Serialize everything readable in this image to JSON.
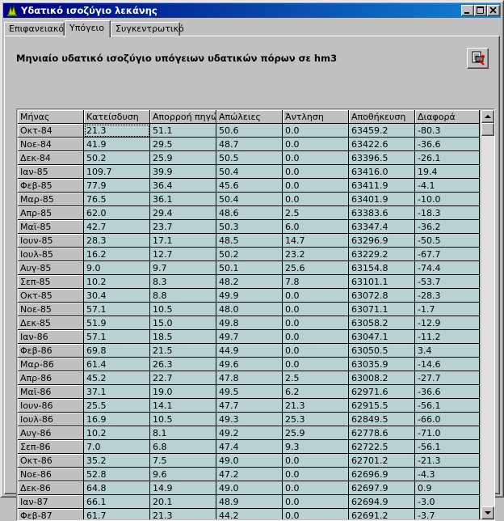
{
  "window": {
    "title": "Υδατικό ισοζύγιο λεκάνης"
  },
  "tabs": [
    {
      "label": "Επιφανειακό",
      "active": false
    },
    {
      "label": "Υπόγειο",
      "active": true
    },
    {
      "label": "Συγκεντρωτικό",
      "active": false
    }
  ],
  "heading": "Μηνιαίο υδατικό ισοζύγιο υπόγειων υδατικών πόρων σε hm3",
  "icons": {
    "app": "app-icon",
    "print": "print-report-icon"
  },
  "table": {
    "columns": [
      "Μήνας",
      "Κατείσδυση",
      "Απορροή πηγών",
      "Απώλειες",
      "Άντληση",
      "Αποθήκευση",
      "Διαφορά"
    ],
    "rows": [
      [
        "Οκτ-84",
        "21.3",
        "51.1",
        "50.6",
        "0.0",
        "63459.2",
        "-80.3"
      ],
      [
        "Νοε-84",
        "41.9",
        "29.5",
        "48.7",
        "0.0",
        "63422.6",
        "-36.6"
      ],
      [
        "Δεκ-84",
        "50.2",
        "25.9",
        "50.5",
        "0.0",
        "63396.5",
        "-26.1"
      ],
      [
        "Ιαν-85",
        "109.7",
        "39.9",
        "50.4",
        "0.0",
        "63416.0",
        "19.4"
      ],
      [
        "Φεβ-85",
        "77.9",
        "36.4",
        "45.6",
        "0.0",
        "63411.9",
        "-4.1"
      ],
      [
        "Μαρ-85",
        "76.5",
        "36.1",
        "50.4",
        "0.0",
        "63401.9",
        "-10.0"
      ],
      [
        "Απρ-85",
        "62.0",
        "29.4",
        "48.6",
        "2.5",
        "63383.6",
        "-18.3"
      ],
      [
        "Μαϊ-85",
        "42.7",
        "23.7",
        "50.3",
        "6.0",
        "63347.4",
        "-36.2"
      ],
      [
        "Ιουν-85",
        "28.3",
        "17.1",
        "48.5",
        "14.7",
        "63296.9",
        "-50.5"
      ],
      [
        "Ιουλ-85",
        "16.2",
        "12.7",
        "50.2",
        "23.2",
        "63229.2",
        "-67.7"
      ],
      [
        "Αυγ-85",
        "9.0",
        "9.7",
        "50.1",
        "25.6",
        "63154.8",
        "-74.4"
      ],
      [
        "Σεπ-85",
        "10.2",
        "8.3",
        "48.2",
        "7.8",
        "63101.1",
        "-53.7"
      ],
      [
        "Οκτ-85",
        "30.4",
        "8.8",
        "49.9",
        "0.0",
        "63072.8",
        "-28.3"
      ],
      [
        "Νοε-85",
        "57.1",
        "10.5",
        "48.0",
        "0.0",
        "63071.1",
        "-1.7"
      ],
      [
        "Δεκ-85",
        "51.9",
        "15.0",
        "49.8",
        "0.0",
        "63058.2",
        "-12.9"
      ],
      [
        "Ιαν-86",
        "57.1",
        "18.5",
        "49.7",
        "0.0",
        "63047.1",
        "-11.2"
      ],
      [
        "Φεβ-86",
        "69.8",
        "21.5",
        "44.9",
        "0.0",
        "63050.5",
        "3.4"
      ],
      [
        "Μαρ-86",
        "61.4",
        "26.3",
        "49.6",
        "0.0",
        "63035.9",
        "-14.6"
      ],
      [
        "Απρ-86",
        "45.2",
        "22.7",
        "47.8",
        "2.5",
        "63008.2",
        "-27.7"
      ],
      [
        "Μαϊ-86",
        "37.1",
        "19.0",
        "49.5",
        "6.2",
        "62971.6",
        "-36.6"
      ],
      [
        "Ιουν-86",
        "25.5",
        "14.1",
        "47.7",
        "21.3",
        "62915.5",
        "-56.1"
      ],
      [
        "Ιουλ-86",
        "16.9",
        "10.5",
        "49.3",
        "25.3",
        "62849.5",
        "-66.0"
      ],
      [
        "Αυγ-86",
        "10.2",
        "8.1",
        "49.2",
        "25.9",
        "62778.6",
        "-71.0"
      ],
      [
        "Σεπ-86",
        "7.0",
        "6.8",
        "47.4",
        "9.3",
        "62722.5",
        "-56.1"
      ],
      [
        "Οκτ-86",
        "35.2",
        "7.5",
        "49.0",
        "0.0",
        "62701.2",
        "-21.3"
      ],
      [
        "Νοε-86",
        "52.8",
        "9.6",
        "47.2",
        "0.0",
        "62696.9",
        "-4.3"
      ],
      [
        "Δεκ-86",
        "64.8",
        "14.9",
        "49.0",
        "0.0",
        "62697.9",
        "0.9"
      ],
      [
        "Ιαν-87",
        "66.1",
        "20.1",
        "48.9",
        "0.0",
        "62694.9",
        "-3.0"
      ],
      [
        "Φεβ-87",
        "61.7",
        "21.3",
        "44.2",
        "0.0",
        "62691.2",
        "-3.7"
      ]
    ]
  },
  "colors": {
    "title_bar": "#000080",
    "cell_background": "#b7d1d4",
    "face": "#c0c0c0"
  }
}
